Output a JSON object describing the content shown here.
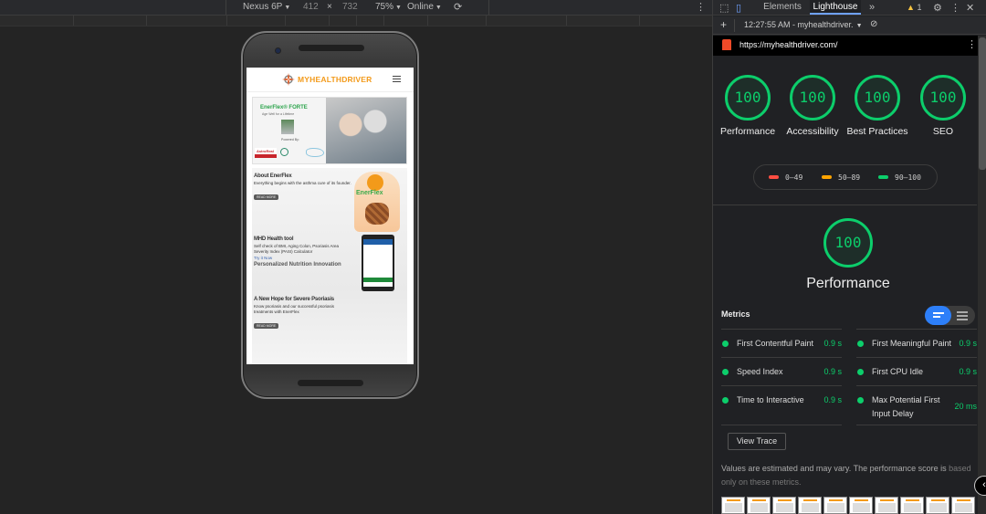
{
  "device_toolbar": {
    "device": "Nexus 6P",
    "width": "412",
    "times": "×",
    "height": "732",
    "zoom": "75%",
    "network": "Online"
  },
  "site": {
    "logo_text": "MYHEALTHDRIVER",
    "hero": {
      "brand": "EnerFlex® FORTE",
      "tagline": "Age Well for a Lifetime",
      "powered_by": "Powered By:",
      "partner1": "AstroReal"
    },
    "sections": [
      {
        "title": "About EnerFlex",
        "text": "Everything begins with the asthma cure of its founder.",
        "button": "READ MORE",
        "figure_text": "EnerFlex"
      },
      {
        "title": "MHD Health tool",
        "text": "Self check of BMI, Aging Colon, Psoriasis Area Severity Index (PASI) Calculator",
        "link": "Try it Now"
      },
      {
        "title": "A New Hope for Severe Psoriasis",
        "text": "Know psoriasis and our successful psoriasis treatments with EnerFlex",
        "button": "READ MORE"
      }
    ],
    "cut_heading": "Personalized Nutrition Innovation"
  },
  "devtools": {
    "tabs": [
      "Elements",
      "Lighthouse"
    ],
    "more": "»",
    "warnings": "1",
    "report_time": "12:27:55 AM - myhealthdriver.",
    "url": "https://myhealthdriver.com/",
    "scores": [
      {
        "label": "Performance",
        "score": "100"
      },
      {
        "label": "Accessibility",
        "score": "100"
      },
      {
        "label": "Best Practices",
        "score": "100"
      },
      {
        "label": "SEO",
        "score": "100"
      }
    ],
    "legend": [
      {
        "range": "0–49",
        "color": "#ff4e42"
      },
      {
        "range": "50–89",
        "color": "#ffa400"
      },
      {
        "range": "90–100",
        "color": "#0cce6b"
      }
    ],
    "performance": {
      "score": "100",
      "label": "Performance"
    },
    "metrics_title": "Metrics",
    "metrics": [
      {
        "name": "First Contentful Paint",
        "value": "0.9 s"
      },
      {
        "name": "First Meaningful Paint",
        "value": "0.9 s"
      },
      {
        "name": "Speed Index",
        "value": "0.9 s"
      },
      {
        "name": "First CPU Idle",
        "value": "0.9 s"
      },
      {
        "name": "Time to Interactive",
        "value": "0.9 s"
      },
      {
        "name": "Max Potential First Input Delay",
        "value": "20 ms"
      }
    ],
    "view_trace": "View Trace",
    "note_text": "Values are estimated and may vary. The performance score is ",
    "note_link": "based only on these metrics."
  },
  "colors": {
    "good": "#0cce6b",
    "brand_orange": "#f39a1a",
    "toggle_active": "#2d7ff9"
  }
}
